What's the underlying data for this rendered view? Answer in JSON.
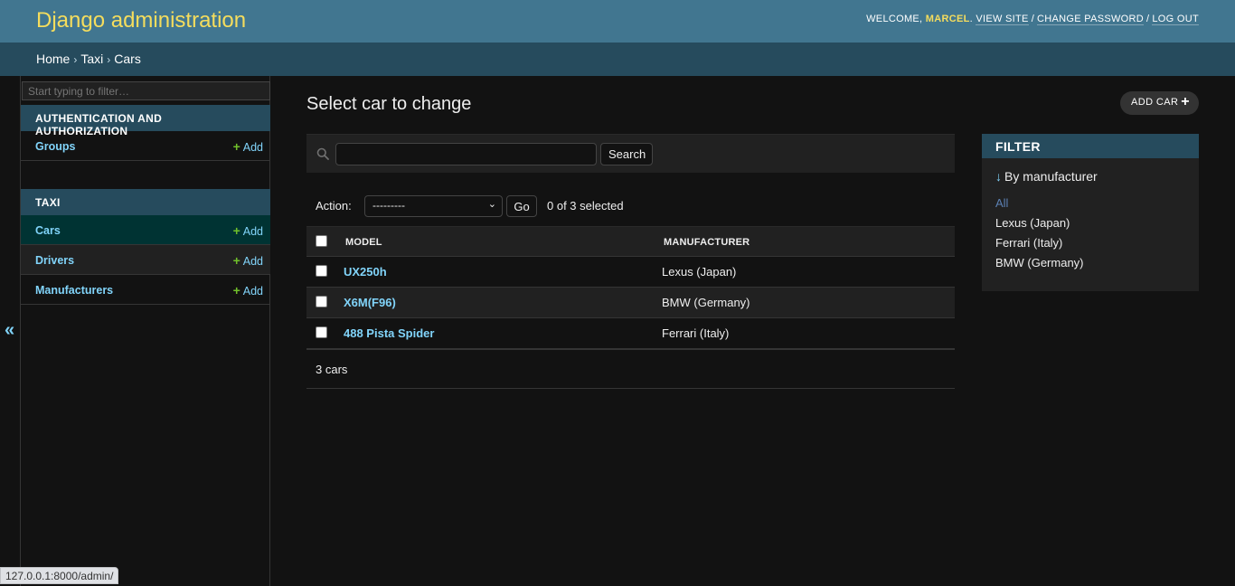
{
  "header": {
    "branding": "Django administration",
    "welcome": "WELCOME,",
    "username": "MARCEL",
    "view_site": "VIEW SITE",
    "change_password": "CHANGE PASSWORD",
    "log_out": "LOG OUT"
  },
  "breadcrumbs": [
    "Home",
    "Taxi",
    "Cars"
  ],
  "sidebar": {
    "filter_placeholder": "Start typing to filter…",
    "apps": [
      {
        "caption": "AUTHENTICATION AND AUTHORIZATION",
        "models": [
          {
            "name": "Groups",
            "add": "Add"
          }
        ]
      },
      {
        "caption": "TAXI",
        "models": [
          {
            "name": "Cars",
            "add": "Add"
          },
          {
            "name": "Drivers",
            "add": "Add"
          },
          {
            "name": "Manufacturers",
            "add": "Add"
          }
        ]
      }
    ],
    "toggle": "«"
  },
  "main": {
    "title": "Select car to change",
    "add_button": "ADD CAR",
    "search_button": "Search",
    "action_label": "Action:",
    "action_selected": "---------",
    "go_button": "Go",
    "selected_count": "0 of 3 selected",
    "columns": [
      "MODEL",
      "MANUFACTURER"
    ],
    "rows": [
      {
        "model": "UX250h",
        "manufacturer": "Lexus (Japan)"
      },
      {
        "model": "X6M(F96)",
        "manufacturer": "BMW (Germany)"
      },
      {
        "model": "488 Pista Spider",
        "manufacturer": "Ferrari (Italy)"
      }
    ],
    "result_count": "3 cars"
  },
  "filter": {
    "title": "FILTER",
    "heading": "By manufacturer",
    "options": [
      "All",
      "Lexus (Japan)",
      "Ferrari (Italy)",
      "BMW (Germany)"
    ],
    "selected": "All"
  },
  "status_url": "127.0.0.1:8000/admin/",
  "colors": {
    "header_bg": "#417690",
    "branding": "#f5dd5d",
    "breadcrumbs_bg": "#264b5d",
    "link": "#81d4fa",
    "add_green": "#70bf2b",
    "body_bg": "#121212"
  }
}
